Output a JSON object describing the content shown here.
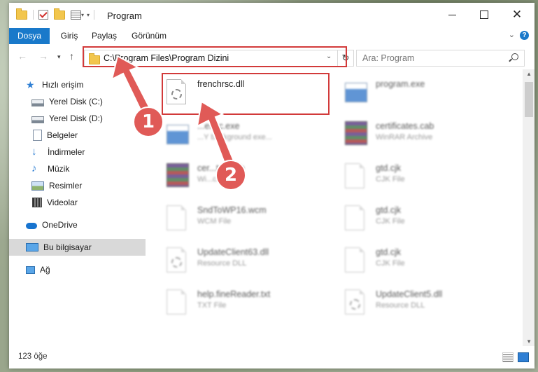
{
  "window": {
    "title": "Program"
  },
  "ribbon": {
    "tabs": [
      "Dosya",
      "Giriş",
      "Paylaş",
      "Görünüm"
    ]
  },
  "address": {
    "path": "C:\\Program Files\\Program Dizini"
  },
  "search": {
    "placeholder": "Ara: Program"
  },
  "nav": {
    "items": [
      {
        "label": "Hızlı erişim",
        "icon": "star-icon"
      },
      {
        "label": "Yerel Disk (C:)",
        "icon": "disk-icon"
      },
      {
        "label": "Yerel Disk (D:)",
        "icon": "disk-icon"
      },
      {
        "label": "Belgeler",
        "icon": "documents-icon"
      },
      {
        "label": "İndirmeler",
        "icon": "download-icon"
      },
      {
        "label": "Müzik",
        "icon": "music-icon"
      },
      {
        "label": "Resimler",
        "icon": "pictures-icon"
      },
      {
        "label": "Videolar",
        "icon": "videos-icon"
      },
      {
        "label": "OneDrive",
        "icon": "cloud-icon"
      },
      {
        "label": "Bu bilgisayar",
        "icon": "computer-icon"
      },
      {
        "label": "Ağ",
        "icon": "network-icon"
      }
    ]
  },
  "files": [
    {
      "name": "frenchrsc.dll",
      "type": "",
      "icon": "dll"
    },
    {
      "name": "program.exe",
      "type": "",
      "icon": "exe"
    },
    {
      "name": "...exec.exe",
      "type": "...Y background exe...",
      "icon": "exe"
    },
    {
      "name": "certificates.cab",
      "type": "WinRAR Archive",
      "icon": "rar"
    },
    {
      "name": "cer...tes.cab",
      "type": "Wi...chive",
      "icon": "rar"
    },
    {
      "name": "gtd.cjk",
      "type": "CJK File",
      "icon": "file"
    },
    {
      "name": "SndToWP16.wcm",
      "type": "WCM File",
      "icon": "file"
    },
    {
      "name": "gtd.cjk",
      "type": "CJK File",
      "icon": "file"
    },
    {
      "name": "UpdateClient63.dll",
      "type": "Resource DLL",
      "icon": "dll"
    },
    {
      "name": "gtd.cjk",
      "type": "CJK File",
      "icon": "file"
    },
    {
      "name": "help.fineReader.txt",
      "type": "TXT File",
      "icon": "file"
    },
    {
      "name": "UpdateClient5.dll",
      "type": "Resource DLL",
      "icon": "dll"
    }
  ],
  "status": {
    "count": "123 öğe"
  },
  "annotations": {
    "badge1": "1",
    "badge2": "2"
  },
  "colors": {
    "accent": "#1979ca",
    "annotation": "#e05a57",
    "highlight": "#d23a3a"
  }
}
